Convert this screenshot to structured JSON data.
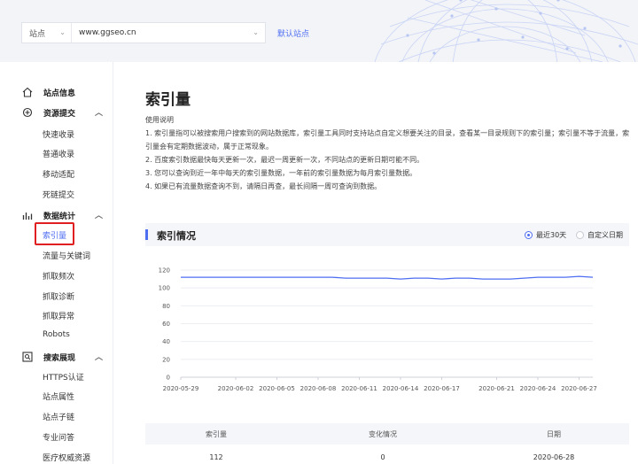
{
  "header": {
    "site_type": "站点",
    "site_domain": "www.ggseo.cn",
    "default_site": "默认站点"
  },
  "sidebar": {
    "groups": [
      {
        "label": "站点信息",
        "icon": "home-icon"
      },
      {
        "label": "资源提交",
        "icon": "submit-icon",
        "items": [
          "快速收录",
          "普通收录",
          "移动适配",
          "死链提交"
        ]
      },
      {
        "label": "数据统计",
        "icon": "stats-icon",
        "items": [
          "索引量",
          "流量与关键词",
          "抓取频次",
          "抓取诊断",
          "抓取异常",
          "Robots"
        ]
      },
      {
        "label": "搜索展现",
        "icon": "search-display-icon",
        "items": [
          "HTTPS认证",
          "站点属性",
          "站点子链",
          "专业问答",
          "医疗权威资源"
        ]
      }
    ],
    "active_item": "索引量"
  },
  "main": {
    "title": "索引量",
    "usage_title": "使用说明",
    "usage_lines": [
      "1. 索引量指可以被搜索用户搜索到的网站数据库，索引量工具同时支持站点自定义想要关注的目录，查看某一目录规则下的索引量；索引量不等于流量，索",
      "引量会有定期数据波动，属于正常现象。",
      "2. 百度索引数据最快每天更新一次，最迟一周更新一次，不同站点的更新日期可能不同。",
      "3. 您可以查询到近一年中每天的索引量数据，一年前的索引量数据为每月索引量数据。",
      "4. 如果已有流量数据查询不到，请隔日再查，最长间隔一周可查询到数据。"
    ],
    "panel_title": "索引情况",
    "range_options": [
      "最近30天",
      "自定义日期"
    ],
    "selected_range": "最近30天"
  },
  "chart_data": {
    "type": "line",
    "x": [
      "2020-05-29",
      "2020-05-30",
      "2020-05-31",
      "2020-06-01",
      "2020-06-02",
      "2020-06-03",
      "2020-06-04",
      "2020-06-05",
      "2020-06-06",
      "2020-06-07",
      "2020-06-08",
      "2020-06-09",
      "2020-06-10",
      "2020-06-11",
      "2020-06-12",
      "2020-06-13",
      "2020-06-14",
      "2020-06-15",
      "2020-06-16",
      "2020-06-17",
      "2020-06-18",
      "2020-06-19",
      "2020-06-20",
      "2020-06-21",
      "2020-06-22",
      "2020-06-23",
      "2020-06-24",
      "2020-06-25",
      "2020-06-26",
      "2020-06-27",
      "2020-06-28"
    ],
    "tick_labels": [
      "2020-05-29",
      "2020-06-02",
      "2020-06-05",
      "2020-06-08",
      "2020-06-11",
      "2020-06-14",
      "2020-06-17",
      "2020-06-21",
      "2020-06-24",
      "2020-06-27"
    ],
    "series": [
      {
        "values": [
          112,
          112,
          112,
          112,
          112,
          112,
          112,
          112,
          112,
          112,
          112,
          112,
          111,
          111,
          111,
          111,
          110,
          111,
          111,
          110,
          111,
          111,
          110,
          110,
          110,
          111,
          112,
          112,
          112,
          113,
          112
        ]
      }
    ],
    "ylim": [
      0,
      120
    ],
    "yticks": [
      0,
      20,
      40,
      60,
      80,
      100,
      120
    ],
    "grid": true,
    "line_color": "#4e6ef2"
  },
  "table": {
    "headers": [
      "索引量",
      "变化情况",
      "日期"
    ],
    "rows": [
      [
        "112",
        "0",
        "2020-06-28"
      ]
    ]
  }
}
